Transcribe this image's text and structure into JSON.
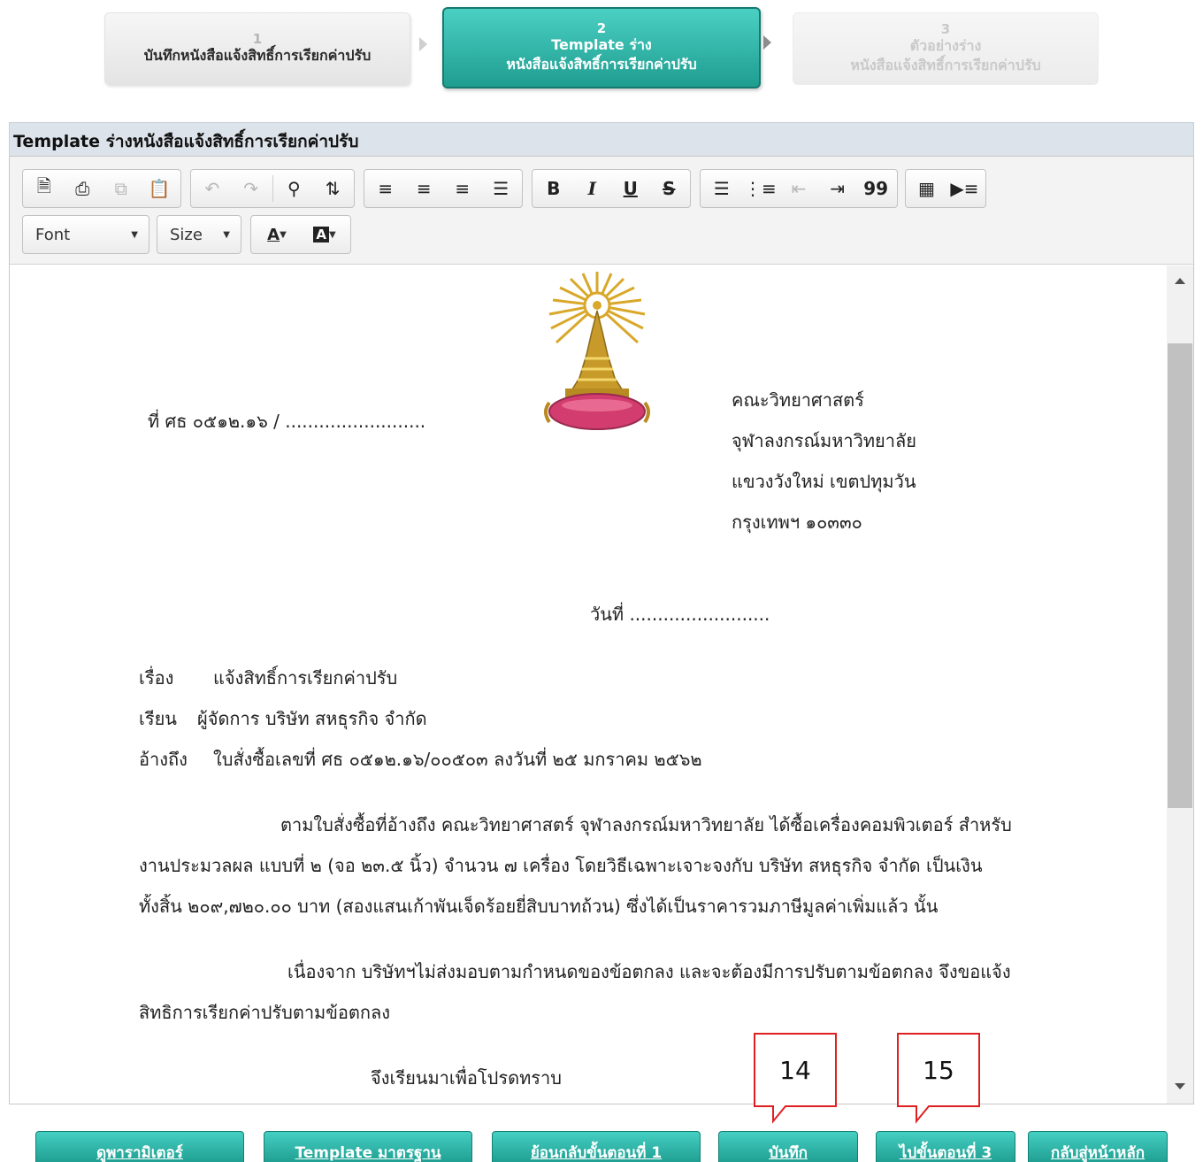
{
  "wizard": {
    "steps": [
      {
        "number": "1",
        "label": "บันทึกหนังสือแจ้งสิทธิ์การเรียกค่าปรับ"
      },
      {
        "number": "2",
        "label_line1": "Template ร่าง",
        "label_line2": "หนังสือแจ้งสิทธิ์การเรียกค่าปรับ"
      },
      {
        "number": "3",
        "label_line1": "ตัวอย่างร่าง",
        "label_line2": "หนังสือแจ้งสิทธิ์การเรียกค่าปรับ"
      }
    ],
    "active_step": 2
  },
  "panel": {
    "title": "Template ร่างหนังสือแจ้งสิทธิ์การเรียกค่าปรับ"
  },
  "toolbar": {
    "font_label": "Font",
    "size_label": "Size",
    "font_color_label": "A",
    "bg_color_label": "A",
    "bold_label": "B",
    "italic_label": "I",
    "underline_label": "U",
    "strike_label": "S",
    "quote_label": "99"
  },
  "document": {
    "ref_no": "ที่  ศธ ๐๕๑๒.๑๖ / .........................",
    "address": [
      "คณะวิทยาศาสตร์",
      "จุฬาลงกรณ์มหาวิทยาลัย",
      "แขวงวังใหม่ เขตปทุมวัน",
      "กรุงเทพฯ ๑๐๓๓๐"
    ],
    "date_line": "วันที่ .........................",
    "subject_label": "เรื่อง",
    "subject": "แจ้งสิทธิ์การเรียกค่าปรับ",
    "to_label": "เรียน",
    "to": "ผู้จัดการ บริษัท สหธุรกิจ จำกัด",
    "ref_label": "อ้างถึง",
    "reference": "ใบสั่งซื้อเลขที่ ศธ ๐๕๑๒.๑๖/๐๐๕๐๓ ลงวันที่ ๒๕ มกราคม ๒๕๖๒",
    "para1": [
      "ตามใบสั่งซื้อที่อ้างถึง คณะวิทยาศาสตร์ จุฬาลงกรณ์มหาวิทยาลัย ได้ซื้อเครื่องคอมพิวเตอร์ สำหรับ",
      "งานประมวลผล แบบที่ ๒ (จอ ๒๓.๕ นิ้ว) จำนวน ๗ เครื่อง โดยวิธีเฉพาะเจาะจงกับ บริษัท สหธุรกิจ จำกัด เป็นเงิน",
      "ทั้งสิ้น ๒๐๙,๗๒๐.๐๐ บาท (สองแสนเก้าพันเจ็ดร้อยยี่สิบบาทถ้วน) ซึ่งได้เป็นราคารวมภาษีมูลค่าเพิ่มแล้ว นั้น"
    ],
    "para2": [
      "เนื่องจาก บริษัทฯไม่ส่งมอบตามกำหนดของข้อตกลง และจะต้องมีการปรับตามข้อตกลง จึงขอแจ้ง",
      "สิทธิการเรียกค่าปรับตามข้อตกลง"
    ],
    "closing": "จึงเรียนมาเพื่อโปรดทราบ"
  },
  "callouts": [
    "14",
    "15"
  ],
  "buttons": {
    "params": "ดูพารามิเตอร์",
    "template_std": "Template มาตรฐาน",
    "back_step1": "ย้อนกลับขั้นตอนที่ 1",
    "save": "บันทึก",
    "to_step3": "ไปขั้นตอนที่ 3",
    "home": "กลับสู่หน้าหลัก"
  },
  "colors": {
    "accent": "#25a89b",
    "callout_border": "#e02020",
    "header_bg": "#dde3ea"
  }
}
